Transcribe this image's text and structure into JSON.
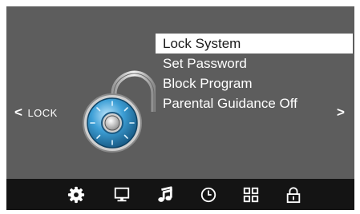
{
  "menu": {
    "items": [
      {
        "label": "Lock System"
      },
      {
        "label": "Set Password"
      },
      {
        "label": "Block Program"
      },
      {
        "label": "Parental Guidance Off"
      }
    ]
  },
  "nav": {
    "prev_label": "LOCK",
    "prev_icon": "chevron-left-icon",
    "next_icon": "chevron-right-icon"
  },
  "colors": {
    "screen_background": "#5d5d5d",
    "bottom_bar": "#141414",
    "selected_item_background": "#ffffff",
    "lock_dial": "#2f8fc4"
  },
  "bottom_bar": {
    "icons": [
      "gear-icon",
      "monitor-icon",
      "music-note-icon",
      "clock-icon",
      "grid-icon",
      "padlock-icon"
    ],
    "active": "padlock-icon"
  }
}
